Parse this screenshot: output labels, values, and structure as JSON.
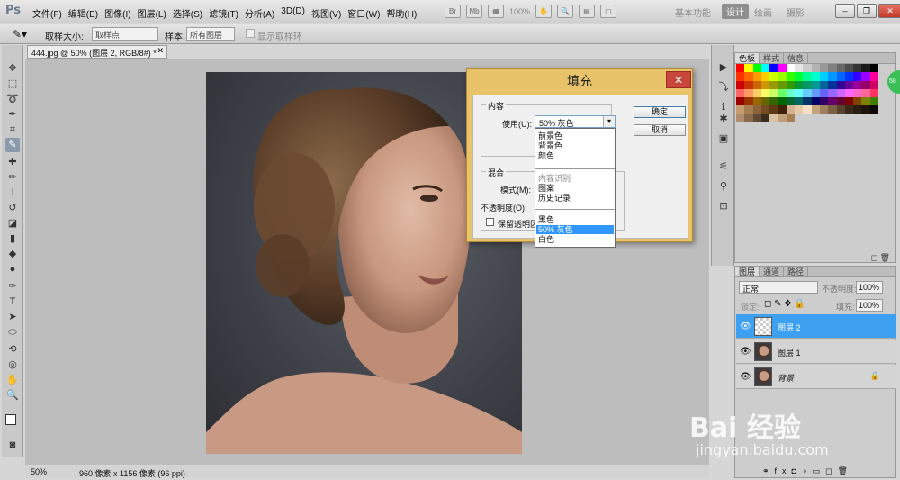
{
  "app": {
    "logo": "Ps",
    "menu": [
      "文件(F)",
      "编辑(E)",
      "图像(I)",
      "图层(L)",
      "选择(S)",
      "滤镜(T)",
      "分析(A)",
      "3D(D)",
      "视图(V)",
      "窗口(W)",
      "帮助(H)"
    ],
    "toolbar_icons": [
      "Br",
      "Mb"
    ],
    "zoom_display": "100%",
    "workspaces": {
      "basic": "基本功能",
      "design": "设计",
      "paint": "绘画",
      "photo": "摄影"
    },
    "win_min": "–",
    "win_restore": "❐",
    "win_close": "✕"
  },
  "options": {
    "sample_size_label": "取样大小:",
    "sample_size_value": "取样点",
    "sample_label": "样本:",
    "sample_value": "所有图层",
    "show_ring_label": "显示取样环"
  },
  "document": {
    "tab_title": "444.jpg @ 50% (图层 2, RGB/8#) *",
    "tab_close": "✕",
    "zoom": "50%",
    "info": "960 像素 x 1156 像素 (96 ppi)"
  },
  "color_panel": {
    "tabs": [
      "色板",
      "样式",
      "信息"
    ],
    "swatch_colors": [
      "#ff0000",
      "#ffff00",
      "#00ff00",
      "#00ffff",
      "#0000ff",
      "#ff00ff",
      "#ffffff",
      "#e6e6e6",
      "#cccccc",
      "#b3b3b3",
      "#999999",
      "#808080",
      "#666666",
      "#4d4d4d",
      "#333333",
      "#1a1a1a",
      "#000000",
      "#ff3300",
      "#ff6600",
      "#ff9900",
      "#ffcc00",
      "#ccff00",
      "#99ff00",
      "#33ff00",
      "#00ff33",
      "#00ff99",
      "#00ffcc",
      "#00ccff",
      "#0099ff",
      "#0066ff",
      "#0033ff",
      "#3300ff",
      "#9900ff",
      "#ff0099",
      "#cc0000",
      "#cc3300",
      "#cc6600",
      "#cc9900",
      "#999900",
      "#669900",
      "#339900",
      "#009933",
      "#009966",
      "#009999",
      "#006699",
      "#003399",
      "#330099",
      "#660099",
      "#990099",
      "#990066",
      "#cc0066",
      "#ff6666",
      "#ff9966",
      "#ffcc66",
      "#ffff66",
      "#ccff66",
      "#66ff66",
      "#66ffcc",
      "#66ffff",
      "#66ccff",
      "#6699ff",
      "#6666ff",
      "#9966ff",
      "#cc66ff",
      "#ff66ff",
      "#ff66cc",
      "#ff6699",
      "#ff3366",
      "#990000",
      "#993300",
      "#996600",
      "#666600",
      "#336600",
      "#006600",
      "#006633",
      "#006666",
      "#003366",
      "#000066",
      "#330066",
      "#660066",
      "#660033",
      "#800000",
      "#804000",
      "#808000",
      "#408000",
      "#c69c6d",
      "#a67c52",
      "#8c6239",
      "#754c24",
      "#603813",
      "#42210b",
      "#d3b394",
      "#e5caa8",
      "#f4dfc4",
      "#c2a37e",
      "#9e7f5e",
      "#7b6045",
      "#58432e",
      "#3b2a1a",
      "#2a1d12",
      "#1c130b",
      "#0f0a05",
      "#b38b6d",
      "#8a6a4f",
      "#604a36",
      "#3a2c1f",
      "#d9c3a5",
      "#bfa07a",
      "#a58055"
    ],
    "foot_icons": [
      "◻",
      "🗑"
    ]
  },
  "layers_panel": {
    "tabs": [
      "图层",
      "通道",
      "路径"
    ],
    "blend_mode": "正常",
    "opacity_label": "不透明度:",
    "opacity_value": "100%",
    "lock_label": "锁定:",
    "fill_label": "填充:",
    "fill_value": "100%",
    "layers": [
      {
        "name": "图层 2",
        "selected": true
      },
      {
        "name": "图层 1",
        "selected": false
      },
      {
        "name": "背景",
        "selected": false
      }
    ]
  },
  "fill_dialog": {
    "title": "填充",
    "close": "✕",
    "content_group": "内容",
    "use_label": "使用(U):",
    "use_value": "50% 灰色",
    "ok": "确定",
    "cancel": "取消",
    "blend_group": "混合",
    "mode_label": "模式(M):",
    "opacity_label": "不透明度(O):",
    "preserve_label": "保留透明区",
    "options": [
      {
        "label": "前景色",
        "state": "normal"
      },
      {
        "label": "背景色",
        "state": "normal"
      },
      {
        "label": "颜色...",
        "state": "normal"
      },
      {
        "label": "内容识别",
        "state": "disabled"
      },
      {
        "label": "图案",
        "state": "normal"
      },
      {
        "label": "历史记录",
        "state": "normal"
      },
      {
        "label": "黑色",
        "state": "normal"
      },
      {
        "label": "50% 灰色",
        "state": "highlighted"
      },
      {
        "label": "白色",
        "state": "normal"
      }
    ]
  },
  "watermark": {
    "main": "Bai 经验",
    "sub": "jingyan.baidu.com"
  }
}
